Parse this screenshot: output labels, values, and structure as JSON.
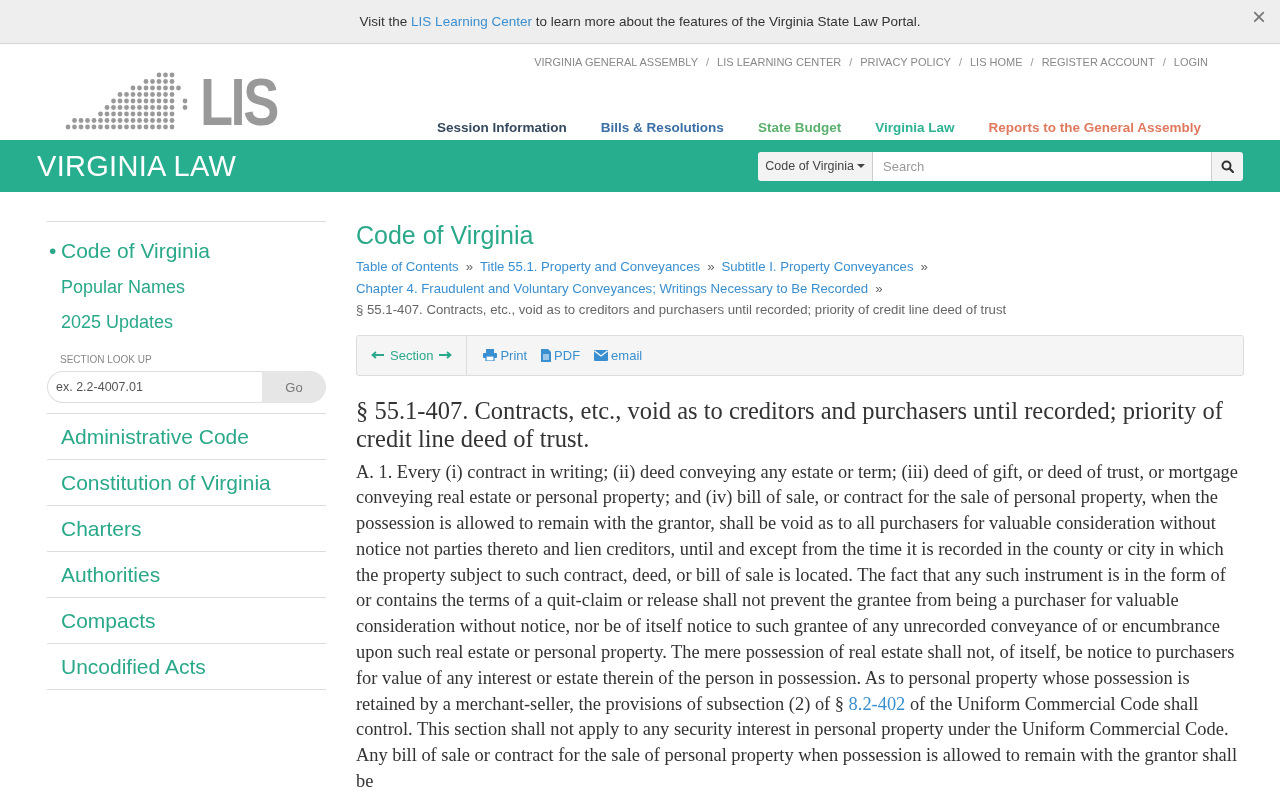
{
  "banner": {
    "before": "Visit the",
    "link": "LIS Learning Center",
    "after": "to learn more about the features of the Virginia State Law Portal.",
    "close": "×"
  },
  "top_links": [
    "VIRGINIA GENERAL ASSEMBLY",
    "LIS LEARNING CENTER",
    "PRIVACY POLICY",
    "LIS HOME",
    "REGISTER ACCOUNT",
    "LOGIN"
  ],
  "top_link_separator": "/",
  "logo": {
    "text": "LIS"
  },
  "main_nav": [
    {
      "label": "Session Information",
      "color": "#34495e"
    },
    {
      "label": "Bills & Resolutions",
      "color": "#3a6ea5"
    },
    {
      "label": "State Budget",
      "color": "#5cb06d"
    },
    {
      "label": "Virginia Law",
      "color": "#2db394"
    },
    {
      "label": "Reports to the General Assembly",
      "color": "#e07a5f"
    }
  ],
  "header": {
    "title": "VIRGINIA LAW",
    "search_scope": "Code of Virginia",
    "search_placeholder": "Search"
  },
  "sidebar": {
    "items": [
      {
        "label": "Code of Virginia",
        "selected": true
      },
      {
        "label": "Popular Names",
        "selected": false
      },
      {
        "label": "2025 Updates",
        "selected": false
      }
    ],
    "selected_marker": "•",
    "lookup_label": "SECTION LOOK UP",
    "lookup_placeholder": "ex. 2.2-4007.01",
    "lookup_button": "Go",
    "sections": [
      "Administrative Code",
      "Constitution of Virginia",
      "Charters",
      "Authorities",
      "Compacts",
      "Uncodified Acts"
    ]
  },
  "content": {
    "title": "Code of Virginia",
    "breadcrumbs": [
      "Table of Contents",
      "Title 55.1. Property and Conveyances",
      "Subtitle I. Property Conveyances",
      "Chapter 4. Fraudulent and Voluntary Conveyances; Writings Necessary to Be Recorded"
    ],
    "breadcrumb_separator": "»",
    "breadcrumb_current": "§ 55.1-407. Contracts, etc., void as to creditors and purchasers until recorded; priority of credit line deed of trust",
    "toolbar": {
      "section": "Section",
      "print": "Print",
      "pdf": "PDF",
      "email": "email"
    },
    "heading": "§ 55.1-407. Contracts, etc., void as to creditors and purchasers until recorded; priority of credit line deed of trust.",
    "paragraph": {
      "before": "A. 1. Every (i) contract in writing; (ii) deed conveying any estate or term; (iii) deed of gift, or deed of trust, or mortgage conveying real estate or personal property; and (iv) bill of sale, or contract for the sale of personal property, when the possession is allowed to remain with the grantor, shall be void as to all purchasers for valuable consideration without notice not parties thereto and lien creditors, until and except from the time it is recorded in the county or city in which the property subject to such contract, deed, or bill of sale is located. The fact that any such instrument is in the form of or contains the terms of a quit-claim or release shall not prevent the grantee from being a purchaser for valuable consideration without notice, nor be of itself notice to such grantee of any unrecorded conveyance of or encumbrance upon such real estate or personal property. The mere possession of real estate shall not, of itself, be notice to purchasers for value of any interest or estate therein of the person in possession. As to personal property whose possession is retained by a merchant-seller, the provisions of subsection (2) of §",
      "link": "8.2-402",
      "after": "of the Uniform Commercial Code shall control. This section shall not apply to any security interest in personal property under the Uniform Commercial Code. Any bill of sale or contract for the sale of personal property when possession is allowed to remain with the grantor shall be"
    }
  }
}
